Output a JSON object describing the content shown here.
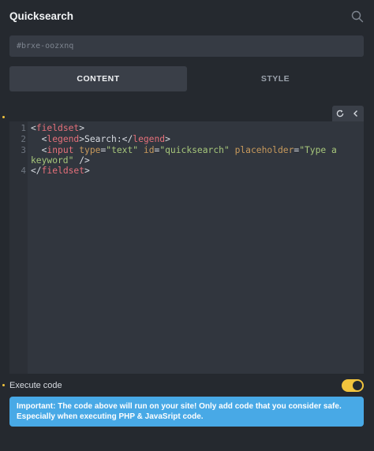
{
  "header": {
    "title": "Quicksearch",
    "search_icon": "search-icon"
  },
  "element_id": {
    "value": "#brxe-oozxnq"
  },
  "tabs": [
    {
      "label": "CONTENT",
      "active": true
    },
    {
      "label": "STYLE",
      "active": false
    }
  ],
  "editor": {
    "toolbar": {
      "refresh_icon": "refresh-icon",
      "collapse_icon": "chevron-left-icon"
    },
    "line_numbers": [
      "1",
      "2",
      "3",
      "4"
    ],
    "lines": {
      "l1": {
        "open": "<",
        "tag": "fieldset",
        "close": ">"
      },
      "l2": {
        "open": "<",
        "tag": "legend",
        "close": ">",
        "text": "Search:",
        "end_open": "</",
        "end_tag": "legend",
        "end_close": ">"
      },
      "l3": {
        "open": "<",
        "tag": "input",
        "a1": "type",
        "eq1": "=",
        "v1": "\"text\"",
        "a2": "id",
        "eq2": "=",
        "v2": "\"quicksearch\"",
        "a3": "placeholder",
        "eq3": "=",
        "v3a": "\"Type a",
        "v3b": "keyword\"",
        "self_close": " />"
      },
      "l4": {
        "open": "</",
        "tag": "fieldset",
        "close": ">"
      }
    }
  },
  "execute": {
    "label": "Execute code",
    "enabled": true
  },
  "notice": {
    "line1": "Important: The code above will run on your site! Only add code that you consider safe.",
    "line2": "Especially when executing PHP & JavaSript code."
  },
  "colors": {
    "background": "#25292f",
    "accent": "#f2c43d",
    "notice": "#48a9e6",
    "tag": "#e5707a",
    "attribute": "#c89a5c",
    "string": "#a7c77b"
  }
}
